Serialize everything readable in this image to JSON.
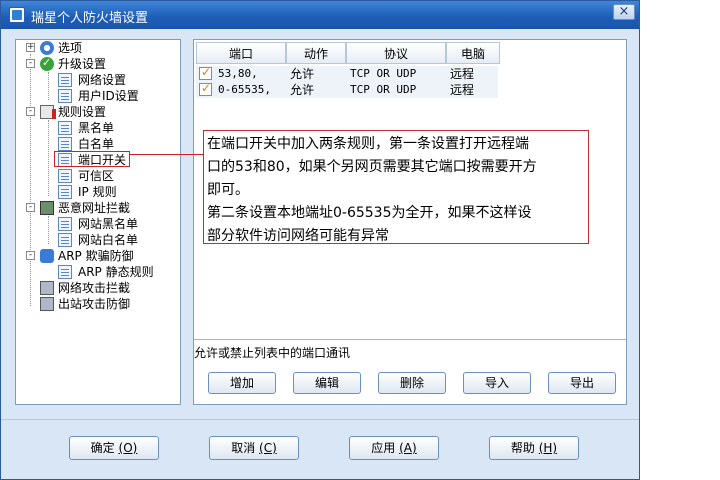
{
  "window": {
    "title": "瑞星个人防火墙设置",
    "close_symbol": "×"
  },
  "tree": {
    "items": [
      {
        "label": "选项"
      },
      {
        "label": "升级设置"
      },
      {
        "label": "网络设置"
      },
      {
        "label": "用户ID设置"
      },
      {
        "label": "规则设置"
      },
      {
        "label": "黑名单"
      },
      {
        "label": "白名单"
      },
      {
        "label": "端口开关"
      },
      {
        "label": "可信区"
      },
      {
        "label": "IP 规则"
      },
      {
        "label": "恶意网址拦截"
      },
      {
        "label": "网站黑名单"
      },
      {
        "label": "网站白名单"
      },
      {
        "label": "ARP 欺骗防御"
      },
      {
        "label": "ARP 静态规则"
      },
      {
        "label": "网络攻击拦截"
      },
      {
        "label": "出站攻击防御"
      }
    ]
  },
  "table": {
    "columns": [
      "端口",
      "动作",
      "协议",
      "电脑"
    ],
    "rows": [
      {
        "port": "53,80,",
        "action": "允许",
        "protocol": "TCP OR UDP",
        "computer": "远程"
      },
      {
        "port": "0-65535,",
        "action": "允许",
        "protocol": "TCP OR UDP",
        "computer": "远程"
      }
    ]
  },
  "description": "允许或禁止列表中的端口通讯",
  "actions": {
    "add": "增加",
    "edit": "编辑",
    "delete": "删除",
    "import": "导入",
    "export": "导出"
  },
  "bottom": {
    "ok": {
      "label": "确定",
      "key": "(O)"
    },
    "cancel": {
      "label": "取消",
      "key": "(C)"
    },
    "apply": {
      "label": "应用",
      "key": "(A)"
    },
    "help": {
      "label": "帮助",
      "key": "(H)"
    }
  },
  "annotation": {
    "line1": "在端口开关中加入两条规则，第一条设置打开远程端",
    "line2": "口的53和80，如果个另网页需要其它端口按需要开方",
    "line3": "即可。",
    "line4": "第二条设置本地端址0-65535为全开，如果不这样设",
    "line5": "部分软件访问网络可能有异常"
  },
  "colors": {
    "title_bar": "#1f5fb9",
    "window_bg": "#d9e6f5",
    "annotation_border": "#c03030"
  }
}
